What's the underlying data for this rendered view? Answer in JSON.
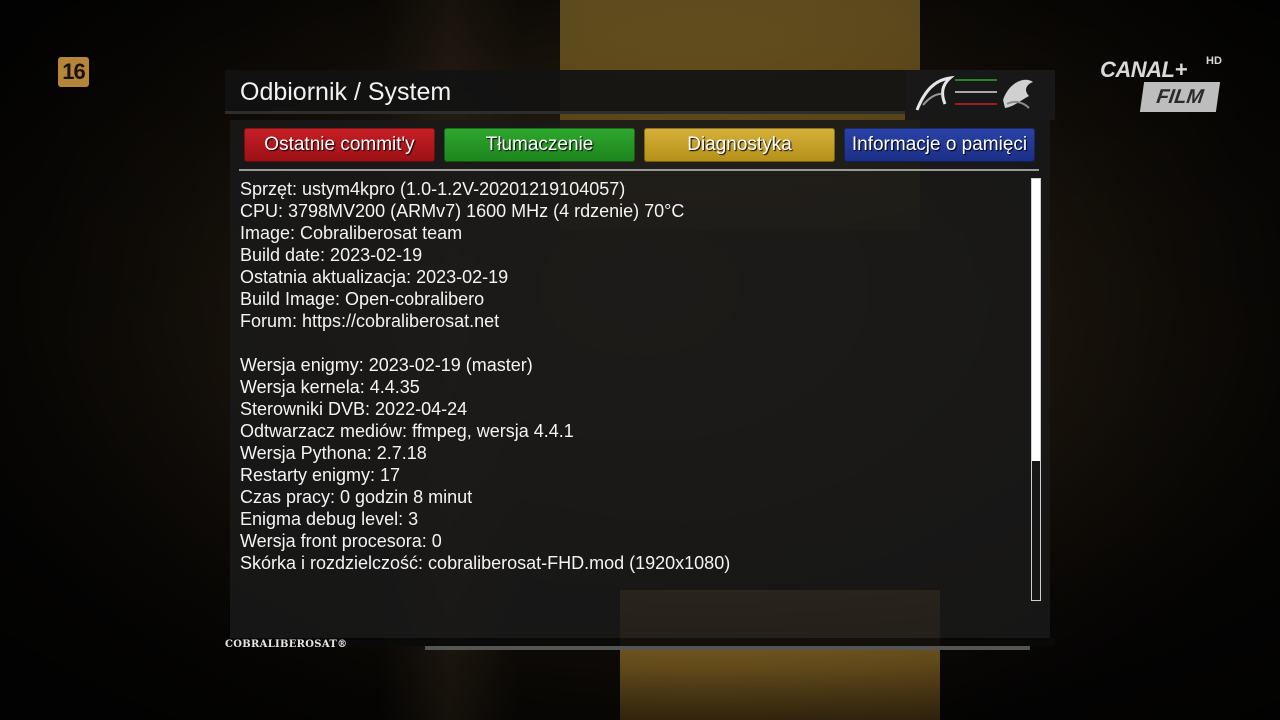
{
  "overlay": {
    "age_rating": "16",
    "channel": {
      "name": "CANAL+",
      "hd": "HD",
      "sub": "FILM"
    }
  },
  "window": {
    "title": "Odbiornik / System",
    "logo_icon": "cobraliberosat-cobra-logo"
  },
  "buttons": {
    "red": "Ostatnie commit'y",
    "green": "Tłumaczenie",
    "yellow": "Diagnostyka",
    "blue": "Informacje o pamięci"
  },
  "colors": {
    "red": "#c62026",
    "green": "#2fa82f",
    "yellow": "#d5b23a",
    "blue": "#2b43a6"
  },
  "info_lines": [
    "Sprzęt: ustym4kpro (1.0-1.2V-20201219104057)",
    "CPU: 3798MV200 (ARMv7) 1600 MHz (4 rdzenie) 70°C",
    "Image: Cobraliberosat team",
    "Build date: 2023-02-19",
    "Ostatnia aktualizacja: 2023-02-19",
    "Build Image: Open-cobralibero",
    "Forum: https://cobraliberosat.net",
    "",
    "Wersja enigmy: 2023-02-19 (master)",
    "Wersja kernela: 4.4.35",
    "Sterowniki DVB: 2022-04-24",
    "Odtwarzacz mediów: ffmpeg, wersja 4.4.1",
    "Wersja Pythona: 2.7.18",
    "Restarty enigmy: 17",
    "Czas pracy: 0 godzin 8 minut",
    "Enigma debug level: 3",
    "Wersja front procesora: 0",
    "Skórka i rozdzielczość: cobraliberosat-FHD.mod (1920x1080)"
  ],
  "scrollbar": {
    "visible_fraction": 0.67
  },
  "footer": {
    "brand": "COBRALIBEROSAT®"
  }
}
